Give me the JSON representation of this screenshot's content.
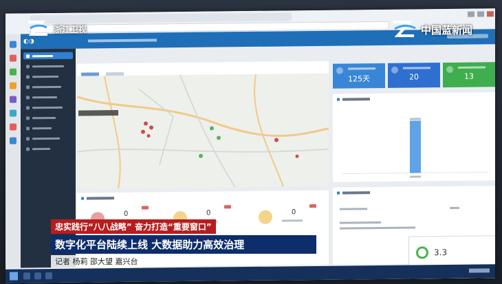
{
  "broadcast": {
    "station_name": "浙江卫视",
    "watermark": "中国蓝新闻",
    "caption_line1": "忠实践行“八八战略” 奋力打造“重要窗口”",
    "caption_line2": "数字化平台陆续上线 大数据助力高效治理",
    "caption_line3": "记者 杨莉 邵大望 嘉兴台"
  },
  "stat_cards": [
    {
      "value": "125天",
      "color": "#3a86d6"
    },
    {
      "value": "20",
      "color": "#2f6fd0"
    },
    {
      "value": "13",
      "color": "#3fae4e"
    }
  ],
  "mini_stats": [
    {
      "value": "0",
      "color": "#e6a0a0"
    },
    {
      "value": "0",
      "color": "#f2d48a"
    },
    {
      "value": "0",
      "color": "#f2d48a"
    }
  ],
  "popup": {
    "score": "3.3"
  },
  "colors": {
    "app_header": "#1f6fb8",
    "nav_bg": "#233042",
    "accent": "#2f81d4"
  }
}
